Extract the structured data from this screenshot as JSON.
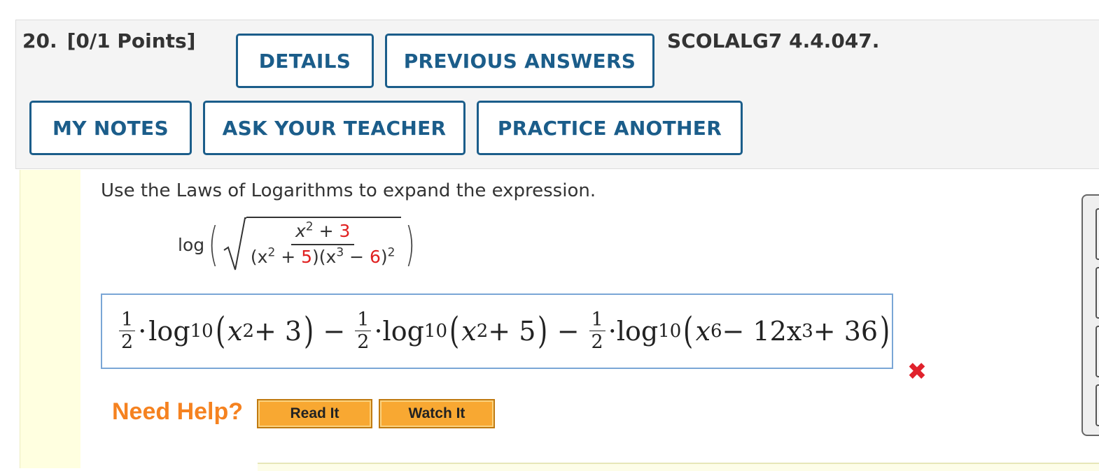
{
  "question": {
    "number": "20.",
    "points": "[0/1 Points]",
    "id": "SCOLALG7 4.4.047."
  },
  "header_buttons": {
    "details": "DETAILS",
    "previous_answers": "PREVIOUS ANSWERS",
    "my_notes": "MY NOTES",
    "ask_teacher": "ASK YOUR TEACHER",
    "practice_another": "PRACTICE ANOTHER"
  },
  "problem": {
    "prompt": "Use the Laws of Logarithms to expand the expression.",
    "log": "log",
    "num_x": "x",
    "num_exp": "2",
    "num_plus": " + ",
    "num_const": "3",
    "den_open": "(x",
    "den_exp1": "2",
    "den_plus": " + ",
    "den_const1": "5",
    "den_mid": ")(x",
    "den_exp2": "3",
    "den_minus": " − ",
    "den_const2": "6",
    "den_close": ")",
    "den_exp3": "2"
  },
  "answer": {
    "half": {
      "num": "1",
      "den": "2"
    },
    "dot": "·",
    "log": "log",
    "base": "10",
    "term1": {
      "var": "x",
      "exp": "2",
      "rest": " + 3"
    },
    "term2": {
      "var": "x",
      "exp": "2",
      "rest": " + 5"
    },
    "term3": {
      "var": "x",
      "exp": "6",
      "mid": " − 12x",
      "exp2": "3",
      "rest": " + 36"
    },
    "minus": "−",
    "status": "incorrect",
    "status_mark": "✖"
  },
  "help": {
    "label": "Need Help?",
    "read_it": "Read It",
    "watch_it": "Watch It"
  },
  "colors": {
    "accent": "#1b5d8a",
    "error": "#e0222c",
    "help": "#f58220",
    "highlight_constants": "#e02020"
  }
}
